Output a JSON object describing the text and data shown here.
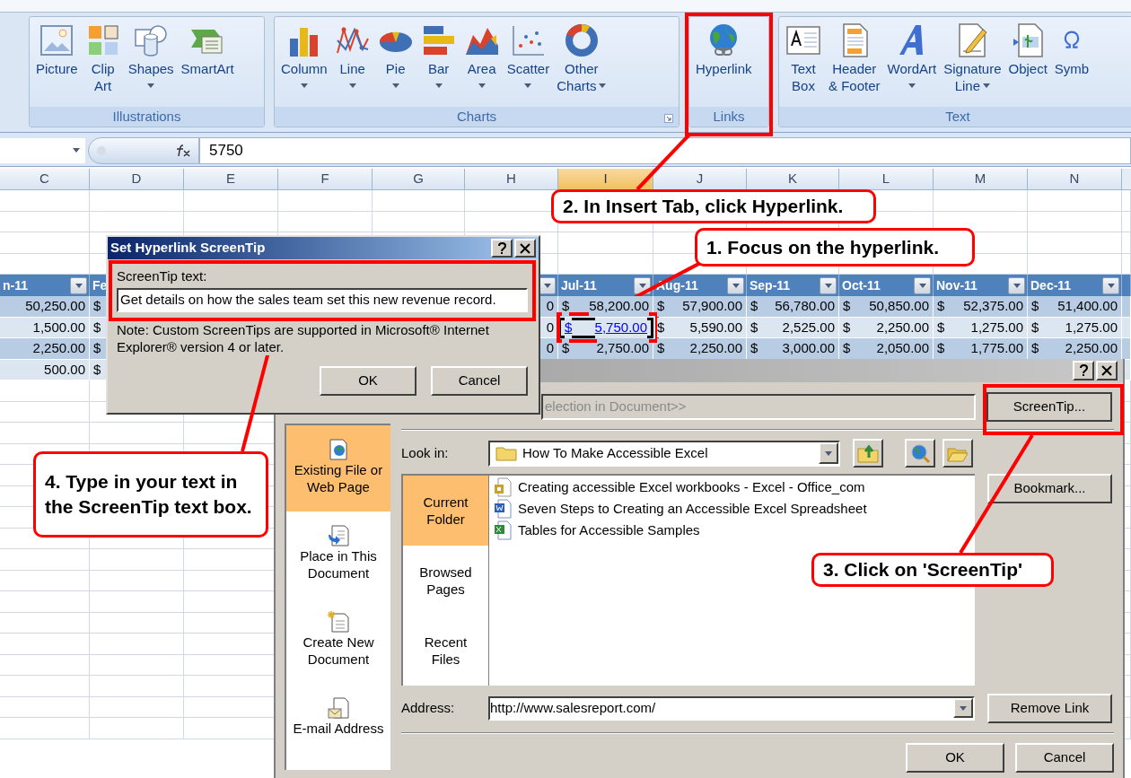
{
  "ribbon": {
    "groups": [
      {
        "title": "Illustrations",
        "launcher": false,
        "buttons": [
          {
            "lines": [
              "Picture"
            ],
            "dropdown": false
          },
          {
            "lines": [
              "Clip",
              "Art"
            ],
            "dropdown": false
          },
          {
            "lines": [
              "Shapes"
            ],
            "dropdown": true
          },
          {
            "lines": [
              "SmartArt"
            ],
            "dropdown": false
          }
        ]
      },
      {
        "title": "Charts",
        "launcher": true,
        "buttons": [
          {
            "lines": [
              "Column"
            ],
            "dropdown": true
          },
          {
            "lines": [
              "Line"
            ],
            "dropdown": true
          },
          {
            "lines": [
              "Pie"
            ],
            "dropdown": true
          },
          {
            "lines": [
              "Bar"
            ],
            "dropdown": true
          },
          {
            "lines": [
              "Area"
            ],
            "dropdown": true
          },
          {
            "lines": [
              "Scatter"
            ],
            "dropdown": true
          },
          {
            "lines": [
              "Other",
              "Charts"
            ],
            "dropdown": true
          }
        ]
      },
      {
        "title": "Links",
        "launcher": false,
        "buttons": [
          {
            "lines": [
              "Hyperlink"
            ],
            "dropdown": false
          }
        ]
      },
      {
        "title": "Text",
        "launcher": false,
        "buttons": [
          {
            "lines": [
              "Text",
              "Box"
            ],
            "dropdown": false
          },
          {
            "lines": [
              "Header",
              "& Footer"
            ],
            "dropdown": false
          },
          {
            "lines": [
              "WordArt"
            ],
            "dropdown": true
          },
          {
            "lines": [
              "Signature",
              "Line"
            ],
            "dropdown": true
          },
          {
            "lines": [
              "Object"
            ],
            "dropdown": false
          },
          {
            "lines": [
              "Symb"
            ],
            "dropdown": false
          }
        ]
      }
    ]
  },
  "formula_bar": {
    "value": "5750"
  },
  "sheet": {
    "columns": [
      {
        "letter": "C",
        "selected": false
      },
      {
        "letter": "D",
        "selected": false
      },
      {
        "letter": "E",
        "selected": false
      },
      {
        "letter": "F",
        "selected": false
      },
      {
        "letter": "G",
        "selected": false
      },
      {
        "letter": "H",
        "selected": false
      },
      {
        "letter": "I",
        "selected": true
      },
      {
        "letter": "J",
        "selected": false
      },
      {
        "letter": "K",
        "selected": false
      },
      {
        "letter": "L",
        "selected": false
      },
      {
        "letter": "M",
        "selected": false
      },
      {
        "letter": "N",
        "selected": false
      }
    ],
    "table_header": {
      "C": {
        "text": "n-11",
        "filter": true
      },
      "D": {
        "text": "Fe",
        "filter": false
      },
      "H": {
        "filter": true
      },
      "I": {
        "text": "Jul-11",
        "filter": true
      },
      "J": {
        "text": "Aug-11",
        "filter": true
      },
      "K": {
        "text": "Sep-11",
        "filter": true
      },
      "L": {
        "text": "Oct-11",
        "filter": true
      },
      "M": {
        "text": "Nov-11",
        "filter": true
      },
      "N": {
        "text": "Dec-11",
        "filter": true
      }
    },
    "table_rows": [
      {
        "C": {
          "amount": "50,250.00",
          "link": false,
          "selected": false
        },
        "D": {
          "currency": "$",
          "link": false,
          "selected": false
        },
        "H": {
          "amount": "0",
          "link": false,
          "selected": false
        },
        "I": {
          "currency": "$",
          "amount": "58,200.00",
          "link": false,
          "selected": false
        },
        "J": {
          "currency": "$",
          "amount": "57,900.00",
          "link": false,
          "selected": false
        },
        "K": {
          "currency": "$",
          "amount": "56,780.00",
          "link": false,
          "selected": false
        },
        "L": {
          "currency": "$",
          "amount": "50,850.00",
          "link": false,
          "selected": false
        },
        "M": {
          "currency": "$",
          "amount": "52,375.00",
          "link": false,
          "selected": false
        },
        "N": {
          "currency": "$",
          "amount": "51,400.00",
          "link": false,
          "selected": false
        }
      },
      {
        "C": {
          "amount": "1,500.00",
          "link": false,
          "selected": false
        },
        "D": {
          "currency": "$",
          "link": false,
          "selected": false
        },
        "H": {
          "amount": "0",
          "link": false,
          "selected": false
        },
        "I": {
          "currency": "$",
          "amount": "5,750.00",
          "link": true,
          "selected": true
        },
        "J": {
          "currency": "$",
          "amount": "5,590.00",
          "link": false,
          "selected": false
        },
        "K": {
          "currency": "$",
          "amount": "2,525.00",
          "link": false,
          "selected": false
        },
        "L": {
          "currency": "$",
          "amount": "2,250.00",
          "link": false,
          "selected": false
        },
        "M": {
          "currency": "$",
          "amount": "1,275.00",
          "link": false,
          "selected": false
        },
        "N": {
          "currency": "$",
          "amount": "1,275.00",
          "link": false,
          "selected": false
        }
      },
      {
        "C": {
          "amount": "2,250.00",
          "link": false,
          "selected": false
        },
        "D": {
          "currency": "$",
          "link": false,
          "selected": false
        },
        "H": {
          "amount": "0",
          "link": false,
          "selected": false
        },
        "I": {
          "currency": "$",
          "amount": "2,750.00",
          "link": false,
          "selected": false
        },
        "J": {
          "currency": "$",
          "amount": "2,250.00",
          "link": false,
          "selected": false
        },
        "K": {
          "currency": "$",
          "amount": "3,000.00",
          "link": false,
          "selected": false
        },
        "L": {
          "currency": "$",
          "amount": "2,050.00",
          "link": false,
          "selected": false
        },
        "M": {
          "currency": "$",
          "amount": "1,775.00",
          "link": false,
          "selected": false
        },
        "N": {
          "currency": "$",
          "amount": "2,250.00",
          "link": false,
          "selected": false
        }
      },
      {
        "C": {
          "amount": "500.00",
          "link": false,
          "selected": false
        },
        "D": {
          "currency": "$",
          "link": false,
          "selected": false
        }
      }
    ]
  },
  "hyperlink_dialog": {
    "display_text": "election in Document>>",
    "screentip_button": "ScreenTip...",
    "link_to": [
      {
        "label": "Existing File or Web Page",
        "selected": true
      },
      {
        "label": "Place in This Document",
        "selected": false
      },
      {
        "label": "Create New Document",
        "selected": false
      },
      {
        "label": "E-mail Address",
        "selected": false
      }
    ],
    "look_in": {
      "label": "Look in:",
      "value": "How To Make Accessible Excel"
    },
    "views": [
      {
        "label": "Current Folder",
        "selected": true
      },
      {
        "label": "Browsed Pages",
        "selected": false
      },
      {
        "label": "Recent Files",
        "selected": false
      }
    ],
    "files": [
      {
        "name": "Creating accessible Excel workbooks - Excel - Office_com",
        "kind": "web"
      },
      {
        "name": "Seven Steps to Creating an Accessible Excel Spreadsheet",
        "kind": "word"
      },
      {
        "name": "Tables for Accessible Samples",
        "kind": "excel"
      }
    ],
    "bookmark_button": "Bookmark...",
    "address": {
      "label": "Address:",
      "value": "http://www.salesreport.com/"
    },
    "remove_button": "Remove Link",
    "buttons": [
      "OK",
      "Cancel"
    ]
  },
  "screentip_dialog": {
    "title": "Set Hyperlink ScreenTip",
    "label": "ScreenTip text:",
    "value": "Get details on how the sales team set this new revenue record.",
    "note": "Note: Custom ScreenTips are supported in Microsoft® Internet Explorer® version 4 or later.",
    "buttons": [
      "OK",
      "Cancel"
    ]
  },
  "callouts": [
    {
      "text": "2. In Insert Tab, click Hyperlink."
    },
    {
      "text": "1. Focus on the hyperlink."
    },
    {
      "text": "4. Type in your text in the ScreenTip text box."
    },
    {
      "text": "3. Click on 'ScreenTip'"
    }
  ]
}
